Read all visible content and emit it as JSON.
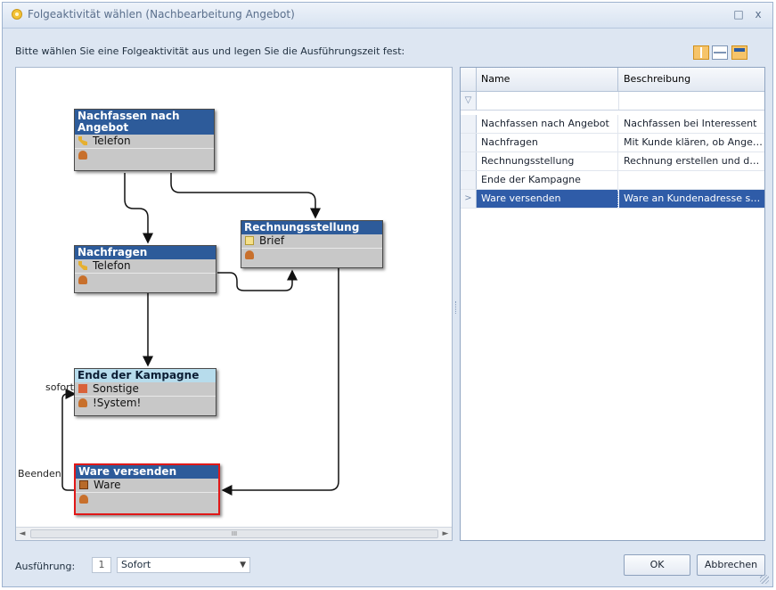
{
  "window": {
    "title": "Folgeaktivität wählen (Nachbearbeitung Angebot)",
    "restore_glyph": "□",
    "close_glyph": "x"
  },
  "instruction": "Bitte wählen Sie eine Folgeaktivität aus und legen Sie die Ausführungszeit fest:",
  "layout_buttons": [
    "layout-vertical-split-icon",
    "layout-horizontal-split-icon",
    "layout-grid-only-icon"
  ],
  "diagram": {
    "nodes": {
      "nachfassen": {
        "title": "Nachfassen nach Angebot",
        "channel": "Telefon",
        "user": ""
      },
      "rechnung": {
        "title": "Rechnungsstellung",
        "channel": "Brief",
        "user": ""
      },
      "nachfragen": {
        "title": "Nachfragen",
        "channel": "Telefon",
        "user": ""
      },
      "ende": {
        "title": "Ende der Kampagne",
        "channel": "Sonstige",
        "user": "!System!"
      },
      "ware": {
        "title": "Ware versenden",
        "channel": "Ware",
        "user": ""
      }
    },
    "labels": {
      "sofort": "sofort",
      "beenden": "Beenden"
    },
    "scroll_thumb_glyph": "III"
  },
  "grid": {
    "columns": [
      "Name",
      "Beschreibung"
    ],
    "filter_icon": "filter-icon",
    "rows": [
      {
        "name": "Nachfassen nach Angebot",
        "desc": "Nachfassen bei Interessent",
        "selected": false
      },
      {
        "name": "Nachfragen",
        "desc": "Mit Kunde klären, ob Angebo...",
        "selected": false
      },
      {
        "name": "Rechnungsstellung",
        "desc": "Rechnung erstellen und dana...",
        "selected": false
      },
      {
        "name": "Ende der Kampagne",
        "desc": "",
        "selected": false
      },
      {
        "name": "Ware versenden",
        "desc": "Ware an Kundenadresse sen...",
        "selected": true
      }
    ]
  },
  "footer": {
    "label": "Ausführung:",
    "number": "1",
    "combo_value": "Sofort",
    "ok": "OK",
    "cancel": "Abbrechen"
  },
  "colors": {
    "node_header": "#2d5b9a",
    "selected_row": "#2f5ca8",
    "selected_node_border": "#e01818"
  }
}
